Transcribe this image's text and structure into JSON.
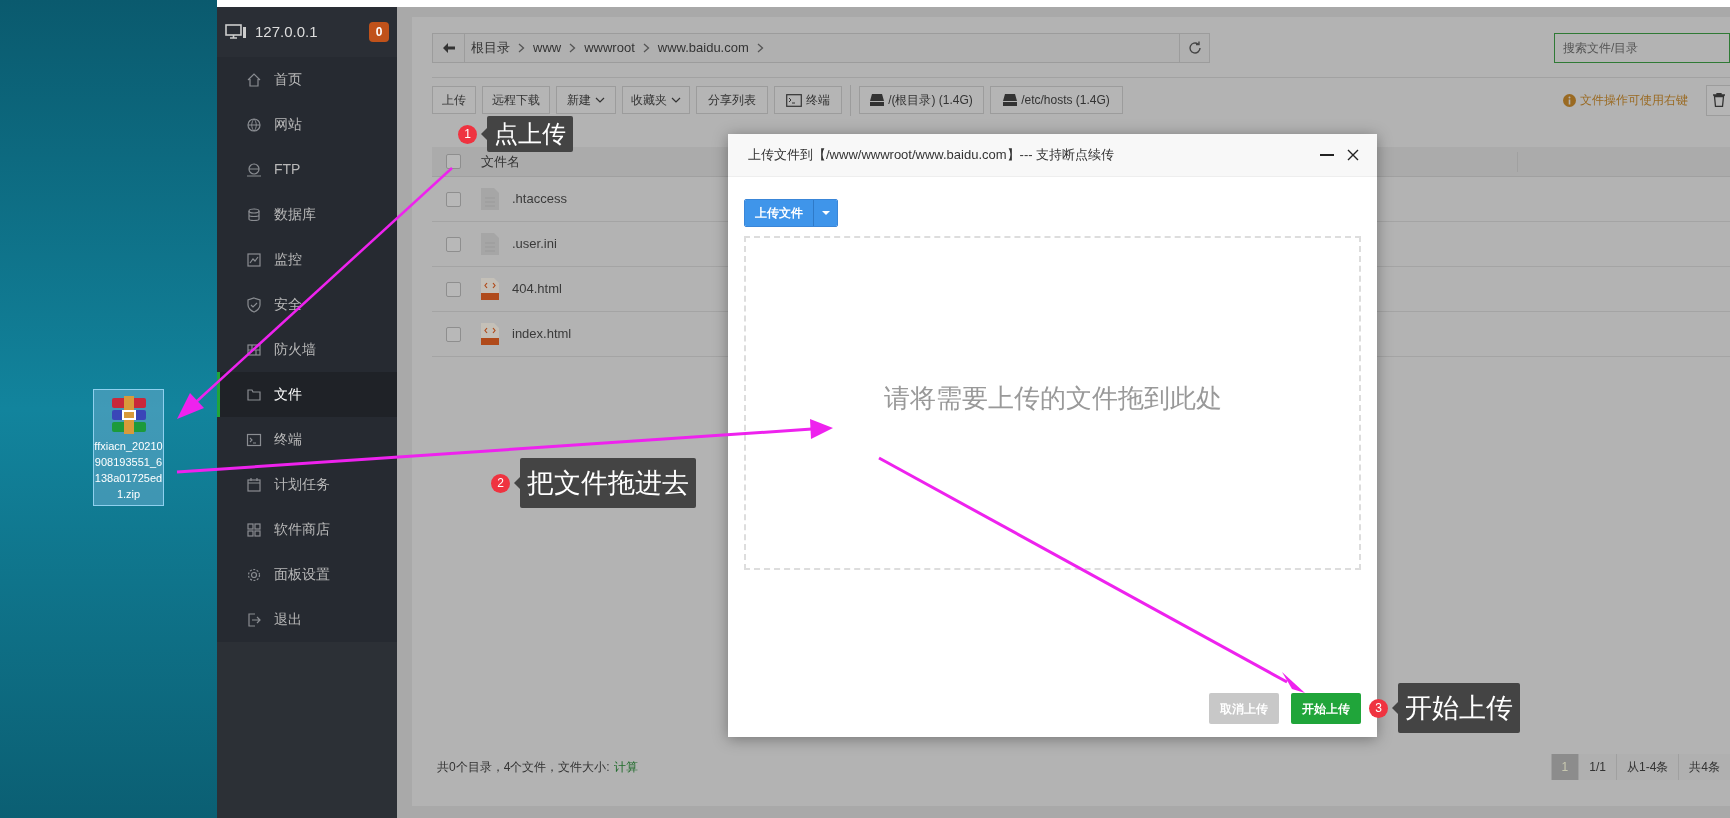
{
  "desktop": {
    "file": {
      "name": "ffxiacn_20210908193551_6138a01725ed1.zip",
      "selected": true
    }
  },
  "sidebar": {
    "host": "127.0.0.1",
    "badge": "0",
    "items": [
      {
        "label": "首页",
        "selected": false
      },
      {
        "label": "网站",
        "selected": false
      },
      {
        "label": "FTP",
        "selected": false
      },
      {
        "label": "数据库",
        "selected": false
      },
      {
        "label": "监控",
        "selected": false
      },
      {
        "label": "安全",
        "selected": false
      },
      {
        "label": "防火墙",
        "selected": false
      },
      {
        "label": "文件",
        "selected": true
      },
      {
        "label": "终端",
        "selected": false
      },
      {
        "label": "计划任务",
        "selected": false
      },
      {
        "label": "软件商店",
        "selected": false
      },
      {
        "label": "面板设置",
        "selected": false
      },
      {
        "label": "退出",
        "selected": false
      }
    ]
  },
  "path_bar": {
    "segments": [
      "根目录",
      "www",
      "wwwroot",
      "www.baidu.com"
    ],
    "search_placeholder": "搜索文件/目录"
  },
  "toolbar": {
    "buttons": [
      {
        "label": "上传",
        "kind": "plain"
      },
      {
        "label": "远程下载",
        "kind": "plain"
      },
      {
        "label": "新建",
        "kind": "dropdown"
      },
      {
        "label": "收藏夹",
        "kind": "dropdown"
      },
      {
        "label": "分享列表",
        "kind": "plain"
      },
      {
        "label": "终端",
        "kind": "terminal"
      },
      {
        "label": "/(根目录) (1.4G)",
        "kind": "disk"
      },
      {
        "label": "/etc/hosts (1.4G)",
        "kind": "disk"
      }
    ],
    "hint": "文件操作可使用右键"
  },
  "table": {
    "header": {
      "label": "文件名",
      "checked": false
    },
    "rows": [
      {
        "name": ".htaccess",
        "kind": "text",
        "checked": false
      },
      {
        "name": ".user.ini",
        "kind": "text",
        "checked": false
      },
      {
        "name": "404.html",
        "kind": "html",
        "checked": false
      },
      {
        "name": "index.html",
        "kind": "html",
        "checked": false
      }
    ]
  },
  "footer": {
    "summary": "共0个目录，4个文件，文件大小:",
    "link": "计算"
  },
  "pagination": [
    {
      "label": "1",
      "selected": true
    },
    {
      "label": "1/1",
      "selected": false
    },
    {
      "label": "从1-4条",
      "selected": false
    },
    {
      "label": "共4条",
      "selected": false
    }
  ],
  "dialog": {
    "title": "上传文件到【/www/wwwroot/www.baidu.com】--- 支持断点续传",
    "upload_button": "上传文件",
    "dropzone_text": "请将需要上传的文件拖到此处",
    "buttons": [
      {
        "label": "取消上传",
        "kind": "cancel"
      },
      {
        "label": "开始上传",
        "kind": "start"
      }
    ]
  },
  "annotations": [
    {
      "number": "1",
      "text": "点上传"
    },
    {
      "number": "2",
      "text": "把文件拖进去"
    },
    {
      "number": "3",
      "text": "开始上传"
    }
  ]
}
